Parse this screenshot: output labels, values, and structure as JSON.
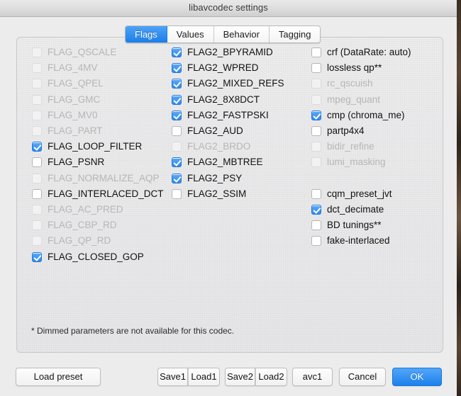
{
  "window": {
    "title": "libavcodec settings"
  },
  "tabs": [
    {
      "label": "Flags",
      "active": true
    },
    {
      "label": "Values",
      "active": false
    },
    {
      "label": "Behavior",
      "active": false
    },
    {
      "label": "Tagging",
      "active": false
    }
  ],
  "columns": {
    "col1": [
      {
        "label": "FLAG_QSCALE",
        "checked": false,
        "enabled": false
      },
      {
        "label": "FLAG_4MV",
        "checked": false,
        "enabled": false
      },
      {
        "label": "FLAG_QPEL",
        "checked": false,
        "enabled": false
      },
      {
        "label": "FLAG_GMC",
        "checked": false,
        "enabled": false
      },
      {
        "label": "FLAG_MV0",
        "checked": false,
        "enabled": false
      },
      {
        "label": "FLAG_PART",
        "checked": false,
        "enabled": false
      },
      {
        "label": "FLAG_LOOP_FILTER",
        "checked": true,
        "enabled": true
      },
      {
        "label": "FLAG_PSNR",
        "checked": false,
        "enabled": true
      },
      {
        "label": "FLAG_NORMALIZE_AQP",
        "checked": false,
        "enabled": false
      },
      {
        "label": "FLAG_INTERLACED_DCT",
        "checked": false,
        "enabled": true
      },
      {
        "label": "FLAG_AC_PRED",
        "checked": false,
        "enabled": false
      },
      {
        "label": "FLAG_CBP_RD",
        "checked": false,
        "enabled": false
      },
      {
        "label": "FLAG_QP_RD",
        "checked": false,
        "enabled": false
      },
      {
        "label": "FLAG_CLOSED_GOP",
        "checked": true,
        "enabled": true
      }
    ],
    "col2": [
      {
        "label": "FLAG2_BPYRAMID",
        "checked": true,
        "enabled": true
      },
      {
        "label": "FLAG2_WPRED",
        "checked": true,
        "enabled": true
      },
      {
        "label": "FLAG2_MIXED_REFS",
        "checked": true,
        "enabled": true
      },
      {
        "label": "FLAG2_8X8DCT",
        "checked": true,
        "enabled": true
      },
      {
        "label": "FLAG2_FASTPSKI",
        "checked": true,
        "enabled": true
      },
      {
        "label": "FLAG2_AUD",
        "checked": false,
        "enabled": true
      },
      {
        "label": "FLAG2_BRDO",
        "checked": false,
        "enabled": false
      },
      {
        "label": "FLAG2_MBTREE",
        "checked": true,
        "enabled": true
      },
      {
        "label": "FLAG2_PSY",
        "checked": true,
        "enabled": true
      },
      {
        "label": "FLAG2_SSIM",
        "checked": false,
        "enabled": true
      }
    ],
    "col3": [
      {
        "label": "crf (DataRate: auto)",
        "checked": false,
        "enabled": true,
        "spacer_after": false
      },
      {
        "label": "lossless qp**",
        "checked": false,
        "enabled": true,
        "spacer_after": false
      },
      {
        "label": "rc_qscuish",
        "checked": false,
        "enabled": false,
        "spacer_after": false
      },
      {
        "label": "mpeg_quant",
        "checked": false,
        "enabled": false,
        "spacer_after": false
      },
      {
        "label": "cmp (chroma_me)",
        "checked": true,
        "enabled": true,
        "spacer_after": false
      },
      {
        "label": "partp4x4",
        "checked": false,
        "enabled": true,
        "spacer_after": false
      },
      {
        "label": "bidir_refine",
        "checked": false,
        "enabled": false,
        "spacer_after": false
      },
      {
        "label": "lumi_masking",
        "checked": false,
        "enabled": false,
        "spacer_after": true
      },
      {
        "label": "cqm_preset_jvt",
        "checked": false,
        "enabled": true,
        "spacer_after": false
      },
      {
        "label": "dct_decimate",
        "checked": true,
        "enabled": true,
        "spacer_after": false
      },
      {
        "label": "BD tunings**",
        "checked": false,
        "enabled": true,
        "spacer_after": false
      },
      {
        "label": "fake-interlaced",
        "checked": false,
        "enabled": true,
        "spacer_after": false
      }
    ]
  },
  "footnote": "* Dimmed parameters are not available for this codec.",
  "buttons": {
    "load_preset": "Load preset",
    "save1": "Save1",
    "load1": "Load1",
    "save2": "Save2",
    "load2": "Load2",
    "avc1": "avc1",
    "cancel": "Cancel",
    "ok": "OK"
  },
  "colors": {
    "accent": "#1d80ec",
    "checkbox_checked": "#2e8bf2",
    "panel_bg": "#ececed",
    "window_bg": "#ececec",
    "dim_text": "#b6b6b6",
    "text": "#111111"
  }
}
